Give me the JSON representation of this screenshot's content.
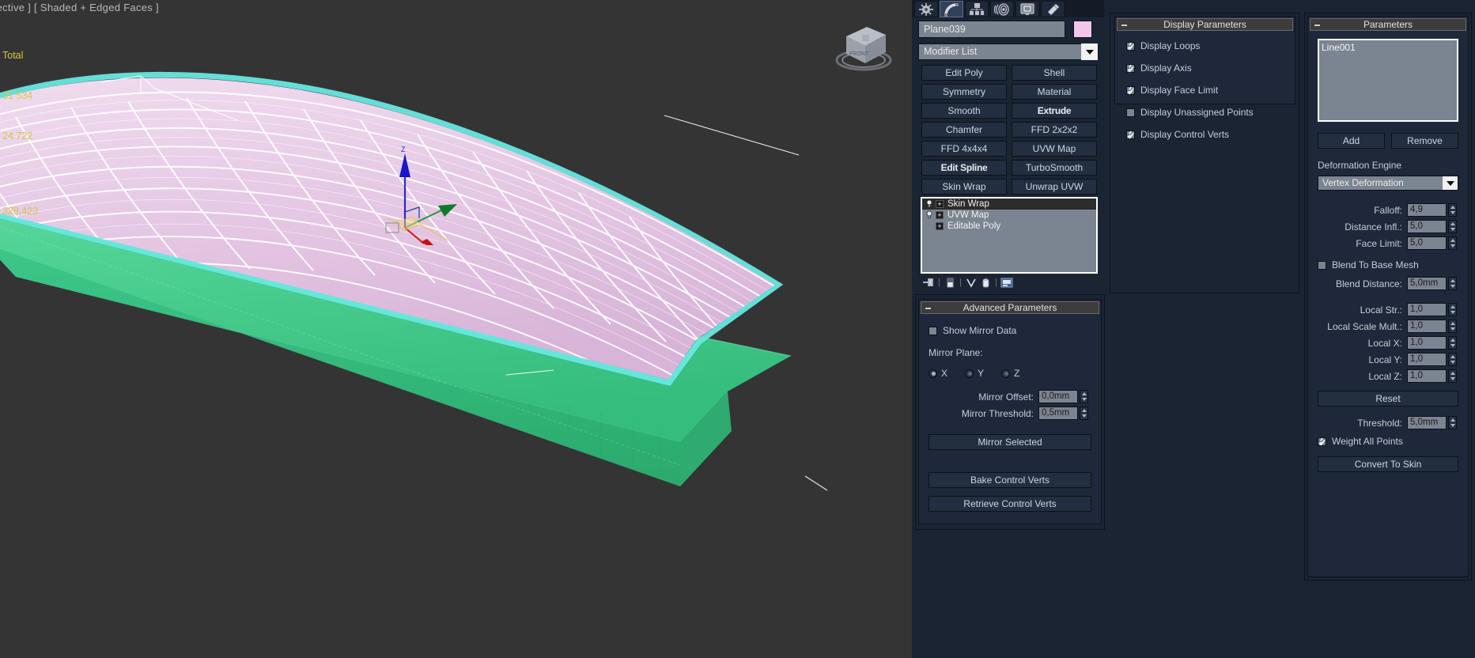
{
  "viewport": {
    "label": "pective ] [ Shaded + Edged Faces ]",
    "stats_title": "Total",
    "stats_verts": "31 534",
    "stats_faces": "24 722",
    "stats_fps": "328,423",
    "axis_z": "Z",
    "colors": {
      "background": "#343434",
      "mesh_fill": "#e6cbe4",
      "mesh_wire": "#ffffff",
      "selection_highlight": "#67e8e0",
      "base_green": "#49d18d",
      "stats_text": "#d4c74a"
    }
  },
  "command_panel": {
    "tabs": [
      {
        "name": "create-tab",
        "icon": "star-icon"
      },
      {
        "name": "modify-tab",
        "icon": "arc-icon",
        "active": true
      },
      {
        "name": "hierarchy-tab",
        "icon": "hierarchy-icon"
      },
      {
        "name": "motion-tab",
        "icon": "motion-icon"
      },
      {
        "name": "display-tab",
        "icon": "display-icon"
      },
      {
        "name": "utilities-tab",
        "icon": "hammer-icon"
      }
    ],
    "object_name": "Plane039",
    "object_color": "#f0c6ea",
    "modifier_list_label": "Modifier List",
    "modifier_buttons": [
      {
        "label": "Edit Poly",
        "bold": false
      },
      {
        "label": "Shell",
        "bold": false
      },
      {
        "label": "Symmetry",
        "bold": false
      },
      {
        "label": "Material",
        "bold": false
      },
      {
        "label": "Smooth",
        "bold": false
      },
      {
        "label": "Extrude",
        "bold": true
      },
      {
        "label": "Chamfer",
        "bold": false
      },
      {
        "label": "FFD 2x2x2",
        "bold": false
      },
      {
        "label": "FFD 4x4x4",
        "bold": false
      },
      {
        "label": "UVW Map",
        "bold": false
      },
      {
        "label": "Edit Spline",
        "bold": true
      },
      {
        "label": "TurboSmooth",
        "bold": false
      },
      {
        "label": "Skin Wrap",
        "bold": false
      },
      {
        "label": "Unwrap UVW",
        "bold": false
      }
    ],
    "modifier_stack": [
      {
        "label": "Skin Wrap",
        "selected": true,
        "has_bulb": true,
        "expandable": true
      },
      {
        "label": "UVW Map",
        "selected": false,
        "has_bulb": true,
        "expandable": true
      },
      {
        "label": "Editable Poly",
        "selected": false,
        "has_bulb": false,
        "expandable": true
      }
    ],
    "stack_toolbar": [
      "pin-stack-icon",
      "show-end-result-icon",
      "make-unique-icon",
      "remove-modifier-icon",
      "configure-modifier-sets-icon"
    ]
  },
  "advanced_parameters": {
    "title": "Advanced Parameters",
    "show_mirror_data": {
      "label": "Show Mirror Data",
      "checked": false
    },
    "mirror_plane_label": "Mirror Plane:",
    "mirror_plane_options": [
      {
        "label": "X",
        "selected": true
      },
      {
        "label": "Y",
        "selected": false
      },
      {
        "label": "Z",
        "selected": false
      }
    ],
    "mirror_offset": {
      "label": "Mirror Offset:",
      "value": "0,0mm"
    },
    "mirror_threshold": {
      "label": "Mirror Threshold:",
      "value": "0,5mm"
    },
    "mirror_selected_btn": "Mirror Selected",
    "bake_control_verts_btn": "Bake Control Verts",
    "retrieve_control_verts_btn": "Retrieve Control Verts"
  },
  "display_parameters": {
    "title": "Display Parameters",
    "items": [
      {
        "label": "Display Loops",
        "checked": true
      },
      {
        "label": "Display Axis",
        "checked": true
      },
      {
        "label": "Display Face Limit",
        "checked": true
      },
      {
        "label": "Display Unassigned Points",
        "checked": false
      },
      {
        "label": "Display Control Verts",
        "checked": true
      }
    ]
  },
  "parameters": {
    "title": "Parameters",
    "bone_list": [
      "Line001"
    ],
    "add_btn": "Add",
    "remove_btn": "Remove",
    "deformation_engine_label": "Deformation Engine",
    "deformation_engine_value": "Vertex Deformation",
    "fields": [
      {
        "label": "Falloff:",
        "value": "4,9"
      },
      {
        "label": "Distance Infl.:",
        "value": "5,0"
      },
      {
        "label": "Face Limit:",
        "value": "5,0"
      }
    ],
    "blend_to_base_mesh": {
      "label": "Blend To Base Mesh",
      "checked": false
    },
    "blend_distance": {
      "label": "Blend Distance:",
      "value": "5,0mm"
    },
    "local_fields": [
      {
        "label": "Local Str.:",
        "value": "1,0"
      },
      {
        "label": "Local Scale Mult.:",
        "value": "1,0"
      },
      {
        "label": "Local X:",
        "value": "1,0"
      },
      {
        "label": "Local Y:",
        "value": "1,0"
      },
      {
        "label": "Local Z:",
        "value": "1,0"
      }
    ],
    "reset_btn": "Reset",
    "threshold": {
      "label": "Threshold:",
      "value": "5,0mm"
    },
    "weight_all_points": {
      "label": "Weight All Points",
      "checked": true
    },
    "convert_to_skin_btn": "Convert To Skin"
  }
}
